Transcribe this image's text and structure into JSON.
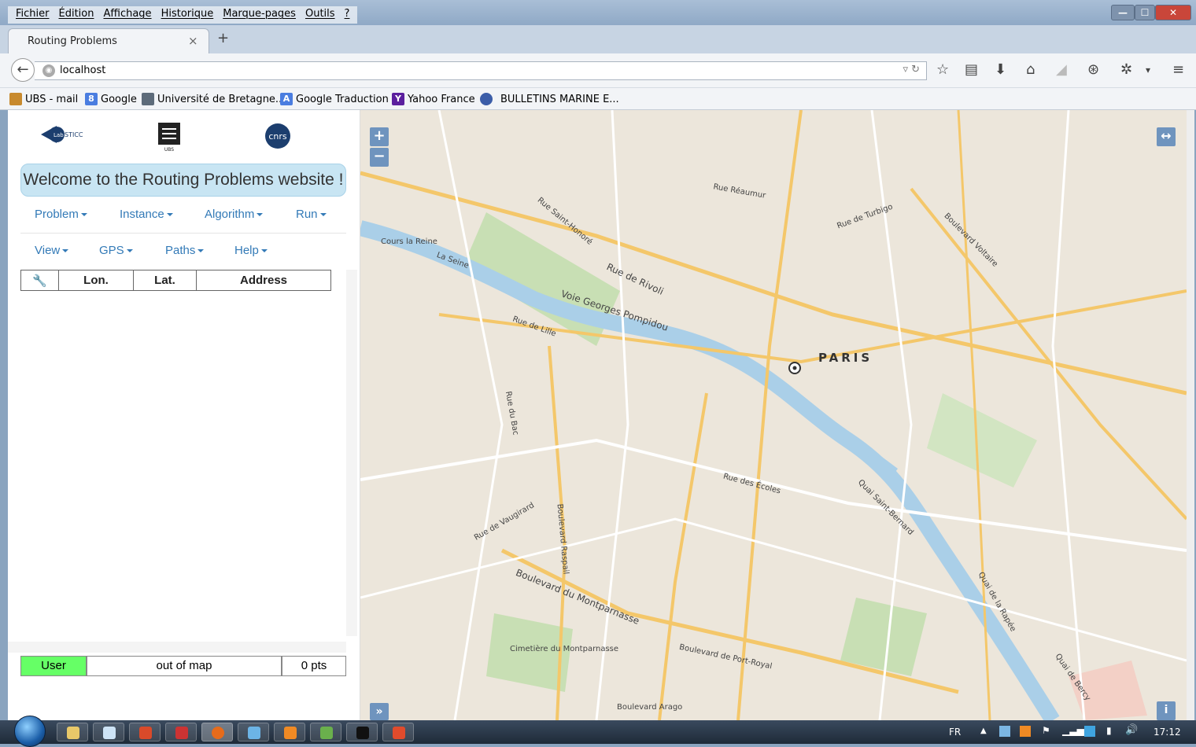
{
  "menubar": [
    "Fichier",
    "Édition",
    "Affichage",
    "Historique",
    "Marque-pages",
    "Outils",
    "?"
  ],
  "window_buttons": {
    "minimize": "—",
    "maximize": "☐",
    "close": "✕"
  },
  "tab": {
    "title": "Routing Problems",
    "close": "×",
    "new": "+"
  },
  "url": "localhost",
  "bookmarks": [
    {
      "label": "UBS - mail",
      "icon": "ubs-icon",
      "color": "#c88a2e"
    },
    {
      "label": "Google",
      "icon": "google-icon",
      "color": "#4a7de0"
    },
    {
      "label": "Université de Bretagne...",
      "icon": "university-icon",
      "color": "#5d6b7a"
    },
    {
      "label": "Google Traduction",
      "icon": "translate-icon",
      "color": "#4a7de0"
    },
    {
      "label": "Yahoo France",
      "icon": "yahoo-icon",
      "color": "#5b1f9e"
    },
    {
      "label": "BULLETINS MARINE E...",
      "icon": "marine-icon",
      "color": "#3b5da8"
    }
  ],
  "logos": {
    "lab": "STICC",
    "lab_prefix": "Lab",
    "ubs": "UBS",
    "cnrs": "cnrs"
  },
  "welcome": "Welcome to the Routing Problems website !",
  "menu_row1": [
    "Problem",
    "Instance",
    "Algorithm",
    "Run"
  ],
  "menu_row2": [
    "View",
    "GPS",
    "Paths",
    "Help"
  ],
  "table_headers": [
    "Lon.",
    "Lat.",
    "Address"
  ],
  "status": {
    "user": "User",
    "location": "out of map",
    "points": "0 pts",
    "user_color": "#66ff66"
  },
  "map": {
    "zoom_in": "+",
    "zoom_out": "−",
    "expand": "↔",
    "toggle": "»",
    "info": "i",
    "city": "PARIS",
    "streets": [
      "La Seine",
      "Rue de Rivoli",
      "Voie Georges Pompidou",
      "Boulevard du Montparnasse",
      "Quai Saint-Bernard",
      "Boulevard Voltaire",
      "Rue de Turbigo",
      "Rue Réaumur",
      "Cours la Reine",
      "Boulevard Raspail",
      "Rue de Vaugirard",
      "Quai de la Rapée",
      "Boulevard Arago",
      "Quai de Bercy",
      "Rue des Écoles",
      "Cimetière du Montparnasse",
      "Boulevard de Port-Royal",
      "Rue Saint-Honoré",
      "Rue de Lille",
      "Rue du Bac"
    ]
  },
  "tray": {
    "lang": "FR",
    "time": "17:12"
  }
}
